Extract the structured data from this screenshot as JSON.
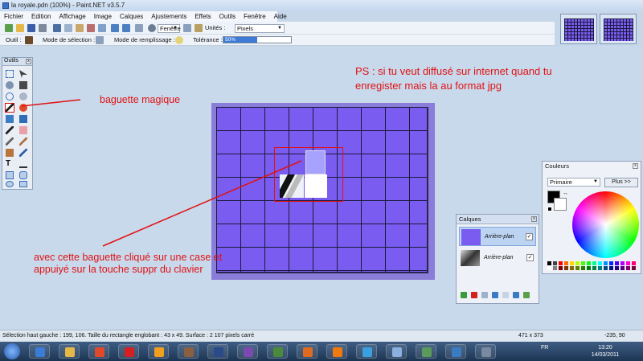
{
  "window": {
    "title": "la royale.pdn (100%) - Paint.NET v3.5.7"
  },
  "menu": {
    "items": [
      "Fichier",
      "Edition",
      "Affichage",
      "Image",
      "Calques",
      "Ajustements",
      "Effets",
      "Outils",
      "Fenêtre",
      "Aide"
    ]
  },
  "toolbar1": {
    "zoom_value": "Fenêtre",
    "units_label": "Unités :",
    "units_value": "Pixels"
  },
  "toolbar2": {
    "tool_label": "Outil :",
    "selection_mode_label": "Mode de sélection :",
    "fill_mode_label": "Mode de remplissage :",
    "tolerance_label": "Tolérance :",
    "tolerance_value": "50%",
    "tolerance_fraction": 0.5
  },
  "tools_window": {
    "title": "Outils",
    "close_glyph": "x"
  },
  "annotations": {
    "magic_wand": "baguette magique",
    "ps_note": "PS : si tu veut diffusé sur internet quand tu enregister mais la au format jpg",
    "instruction": "avec cette baguette cliqué sur une case et appuiyé sur la touche suppr du clavier"
  },
  "layers_window": {
    "title": "Calques",
    "close_glyph": "x",
    "layers": [
      {
        "name": "Arrière-plan",
        "checked": true,
        "selected": true
      },
      {
        "name": "Arrière-plan",
        "checked": true,
        "selected": false
      }
    ],
    "checkmark": "✓"
  },
  "colors_window": {
    "title": "Couleurs",
    "close_glyph": "x",
    "mode_value": "Primaire",
    "more_button": "Plus >>"
  },
  "status_bar": {
    "selection_info": "Sélection haut gauche : 199, 106. Taille du rectangle englobant : 43 x 49. Surface : 2 107 pixels carré",
    "image_size": "471 x 373",
    "cursor_pos": "-235, 90"
  },
  "taskbar": {
    "language": "FR",
    "time": "13:20",
    "date": "14/03/2011",
    "apps": [
      "ie-icon",
      "explorer-icon",
      "chrome-icon",
      "filezilla-icon",
      "winamp-icon",
      "gimp-icon",
      "paintnet-icon",
      "fs-icon",
      "minecraft-icon",
      "firefox-icon",
      "vlc-icon",
      "chrome2-icon",
      "itunes-icon",
      "pidgin-icon",
      "messenger-icon",
      "media-icon"
    ]
  },
  "colors": {
    "accent_red": "#e01212",
    "image_purple": "#7a5cf0",
    "grid_line": "#1a1a3a"
  }
}
